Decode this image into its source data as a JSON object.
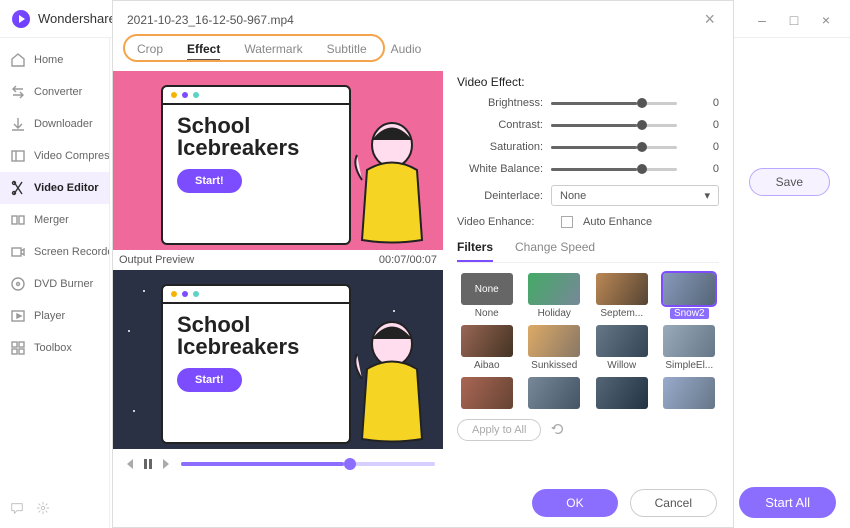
{
  "app": {
    "title": "Wondershare"
  },
  "window_buttons": {
    "menu": "≡",
    "minimize": "–",
    "maximize": "□",
    "close": "×"
  },
  "sidebar": {
    "items": [
      {
        "label": "Home"
      },
      {
        "label": "Converter"
      },
      {
        "label": "Downloader"
      },
      {
        "label": "Video Compress"
      },
      {
        "label": "Video Editor"
      },
      {
        "label": "Merger"
      },
      {
        "label": "Screen Recorde"
      },
      {
        "label": "DVD Burner"
      },
      {
        "label": "Player"
      },
      {
        "label": "Toolbox"
      }
    ]
  },
  "content": {
    "save": "Save",
    "start_all": "Start All"
  },
  "modal": {
    "filename": "2021-10-23_16-12-50-967.mp4",
    "tabs": [
      "Crop",
      "Effect",
      "Watermark",
      "Subtitle",
      "Audio"
    ],
    "preview": {
      "card_line1": "School",
      "card_line2": "Icebreakers",
      "start": "Start!",
      "output_label": "Output Preview",
      "time": "00:07/00:07"
    },
    "effects": {
      "title": "Video Effect:",
      "sliders": [
        {
          "label": "Brightness:",
          "value": "0",
          "pos": 68
        },
        {
          "label": "Contrast:",
          "value": "0",
          "pos": 68
        },
        {
          "label": "Saturation:",
          "value": "0",
          "pos": 68
        },
        {
          "label": "White Balance:",
          "value": "0",
          "pos": 68
        }
      ],
      "deinterlace_label": "Deinterlace:",
      "deinterlace_value": "None",
      "enhance_label": "Video Enhance:",
      "auto_enhance": "Auto Enhance"
    },
    "sub_tabs": [
      "Filters",
      "Change Speed"
    ],
    "filters": [
      {
        "label": "None",
        "none": true
      },
      {
        "label": "Holiday"
      },
      {
        "label": "Septem..."
      },
      {
        "label": "Snow2",
        "selected": true
      },
      {
        "label": "Aibao"
      },
      {
        "label": "Sunkissed"
      },
      {
        "label": "Willow"
      },
      {
        "label": "SimpleEl..."
      },
      {
        "label": ""
      },
      {
        "label": ""
      },
      {
        "label": ""
      },
      {
        "label": ""
      }
    ],
    "apply_all": "Apply to All",
    "ok": "OK",
    "cancel": "Cancel"
  }
}
